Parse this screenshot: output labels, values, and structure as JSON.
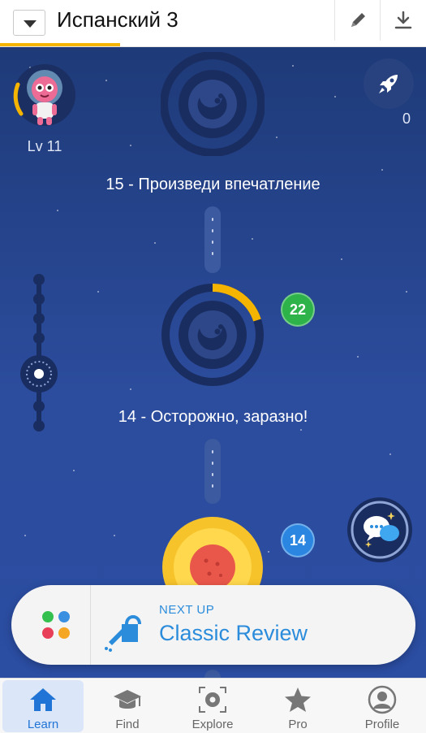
{
  "header": {
    "course_title": "Испанский 3",
    "edit_icon": "pencil-icon",
    "download_icon": "download-icon"
  },
  "user": {
    "level": "Lv 11",
    "rocket_count": "0"
  },
  "lessons": [
    {
      "title": "15 - Произведи впечатление",
      "badge": ""
    },
    {
      "title": "14 - Осторожно, заразно!",
      "badge": "22"
    },
    {
      "title": "",
      "badge": "14"
    }
  ],
  "next_up": {
    "label": "NEXT UP",
    "title": "Classic Review"
  },
  "nav": [
    {
      "label": "Learn",
      "icon": "home-icon",
      "active": true
    },
    {
      "label": "Find",
      "icon": "graduation-cap-icon"
    },
    {
      "label": "Explore",
      "icon": "camera-scan-icon"
    },
    {
      "label": "Pro",
      "icon": "star-icon"
    },
    {
      "label": "Profile",
      "icon": "profile-icon"
    }
  ],
  "colors": {
    "space": "#2c4c9d",
    "accent": "#2b8cdb",
    "progress": "#f4b400",
    "badge_green": "#2db34a",
    "badge_blue": "#2a86e0"
  }
}
